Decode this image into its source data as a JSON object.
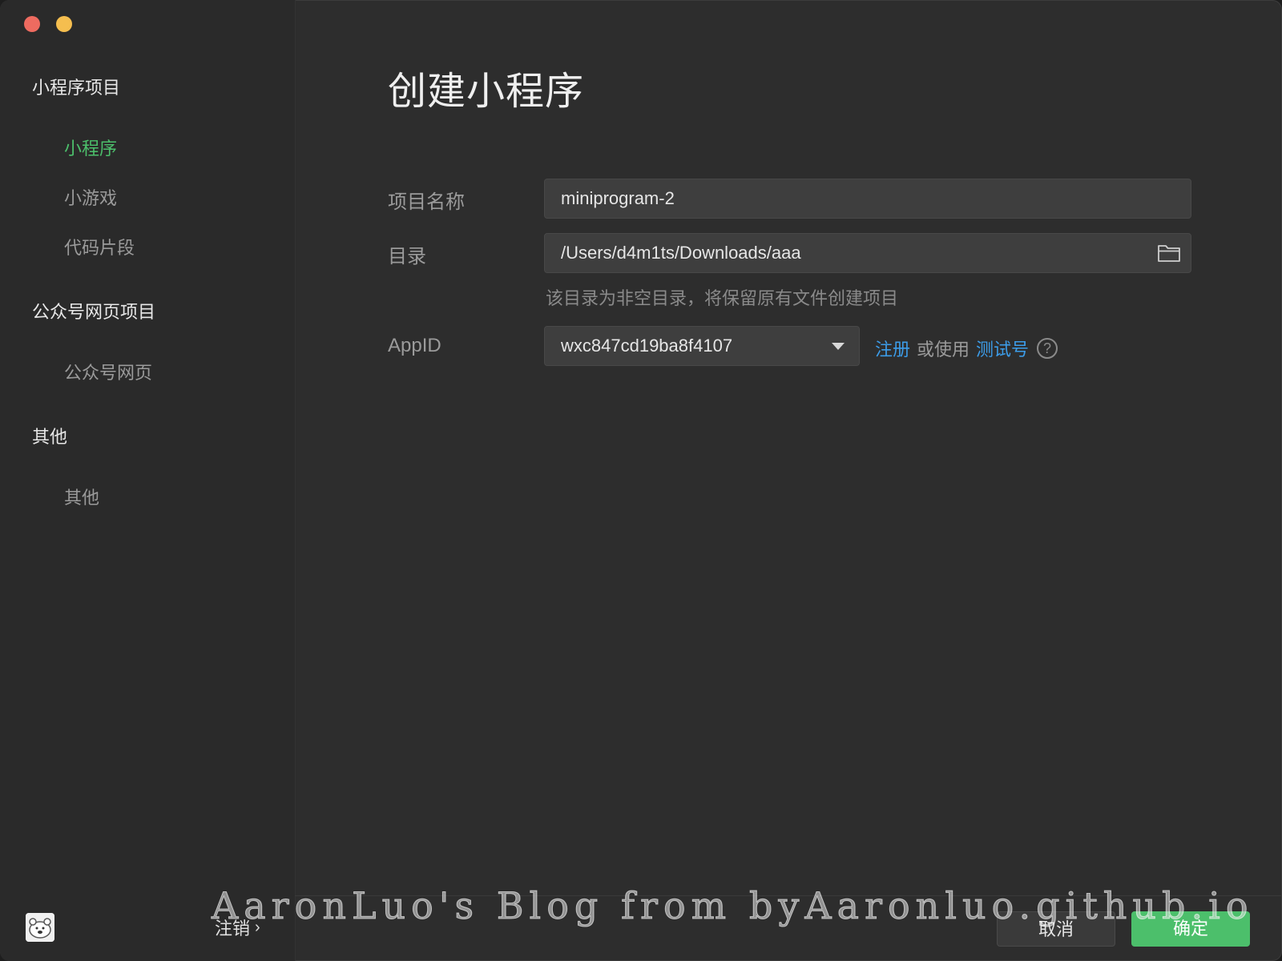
{
  "sidebar": {
    "groups": [
      {
        "title": "小程序项目",
        "items": [
          "小程序",
          "小游戏",
          "代码片段"
        ]
      },
      {
        "title": "公众号网页项目",
        "items": [
          "公众号网页"
        ]
      },
      {
        "title": "其他",
        "items": [
          "其他"
        ]
      }
    ],
    "active_item": "小程序",
    "logout_label": "注销",
    "logout_icon": "chevron-right-icon",
    "avatar_icon": "user-avatar"
  },
  "main": {
    "title": "创建小程序",
    "project_name": {
      "label": "项目名称",
      "value": "miniprogram-2"
    },
    "directory": {
      "label": "目录",
      "value": "/Users/d4m1ts/Downloads/aaa",
      "icon": "folder-icon"
    },
    "directory_hint": "该目录为非空目录，将保留原有文件创建项目",
    "appid": {
      "label": "AppID",
      "value": "wxc847cd19ba8f4107",
      "register_link": "注册",
      "or_use": "或使用",
      "test_link": "测试号",
      "help_icon": "?"
    }
  },
  "footer": {
    "cancel_label": "取消",
    "confirm_label": "确定"
  },
  "watermark": "AaronLuo's Blog from byAaronluo.github.io",
  "colors": {
    "accent": "#4cbf6b",
    "link": "#3c9ce8",
    "background": "#2d2d2d",
    "sidebar": "#2a2a2a"
  }
}
